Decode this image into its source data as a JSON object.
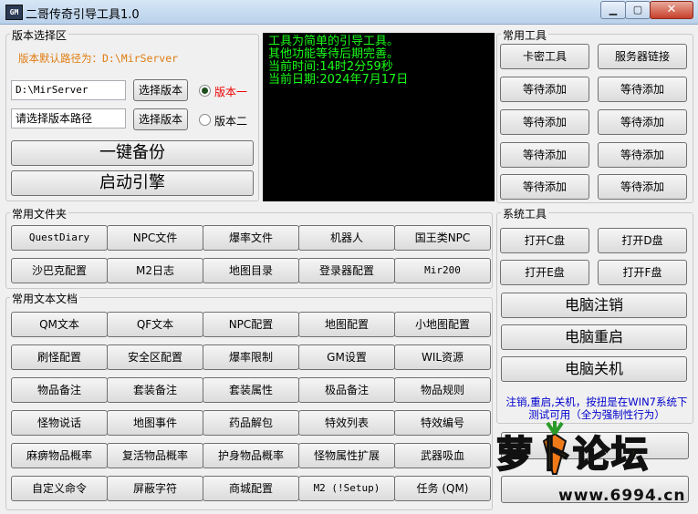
{
  "window": {
    "title": "二哥传奇引导工具1.0",
    "icon_text": "GM"
  },
  "version_group": {
    "label": "版本选择区",
    "default_path_text": "版本默认路径为：D:\\MirServer",
    "path1_value": "D:\\MirServer",
    "path2_placeholder": "请选择版本路径",
    "select_btn": "选择版本",
    "version1": "版本一",
    "version2": "版本二"
  },
  "backup_btn": "一键备份",
  "start_btn": "启动引擎",
  "console": [
    "工具为简单的引导工具。",
    "其他功能等待后期完善。",
    "当前时间:14时2分59秒",
    "当前日期:2024年7月17日"
  ],
  "common_tools": {
    "label": "常用工具",
    "items": [
      "卡密工具",
      "服务器链接",
      "等待添加",
      "等待添加",
      "等待添加",
      "等待添加",
      "等待添加",
      "等待添加",
      "等待添加",
      "等待添加"
    ]
  },
  "common_folders": {
    "label": "常用文件夹",
    "items": [
      "QuestDiary",
      "NPC文件",
      "爆率文件",
      "机器人",
      "国王类NPC",
      "沙巴克配置",
      "M2日志",
      "地图目录",
      "登录器配置",
      "Mir200"
    ]
  },
  "common_docs": {
    "label": "常用文本文档",
    "items": [
      "QM文本",
      "QF文本",
      "NPC配置",
      "地图配置",
      "小地图配置",
      "刷怪配置",
      "安全区配置",
      "爆率限制",
      "GM设置",
      "WIL资源",
      "物品备注",
      "套装备注",
      "套装属性",
      "极品备注",
      "物品规则",
      "怪物说话",
      "地图事件",
      "药品解包",
      "特效列表",
      "特效编号",
      "麻痹物品概率",
      "复活物品概率",
      "护身物品概率",
      "怪物属性扩展",
      "武器吸血",
      "自定义命令",
      "屏蔽字符",
      "商城配置",
      "M2 (!Setup)",
      "任务 (QM)"
    ]
  },
  "system_tools": {
    "label": "系统工具",
    "drives": [
      "打开C盘",
      "打开D盘",
      "打开E盘",
      "打开F盘"
    ],
    "logout": "电脑注销",
    "restart": "电脑重启",
    "shutdown": "电脑关机",
    "note": "注销,重启,关机，按扭是在WIN7系统下测试可用（全为强制性行为）"
  },
  "watermark": {
    "text": "萝卜论坛",
    "url": "www.6994.cn"
  },
  "colors": {
    "console_bg": "#000000",
    "console_text": "#19ff19",
    "accent_orange": "#e07c12",
    "note_blue": "#0000cc",
    "radio_red": "#ee0000"
  }
}
